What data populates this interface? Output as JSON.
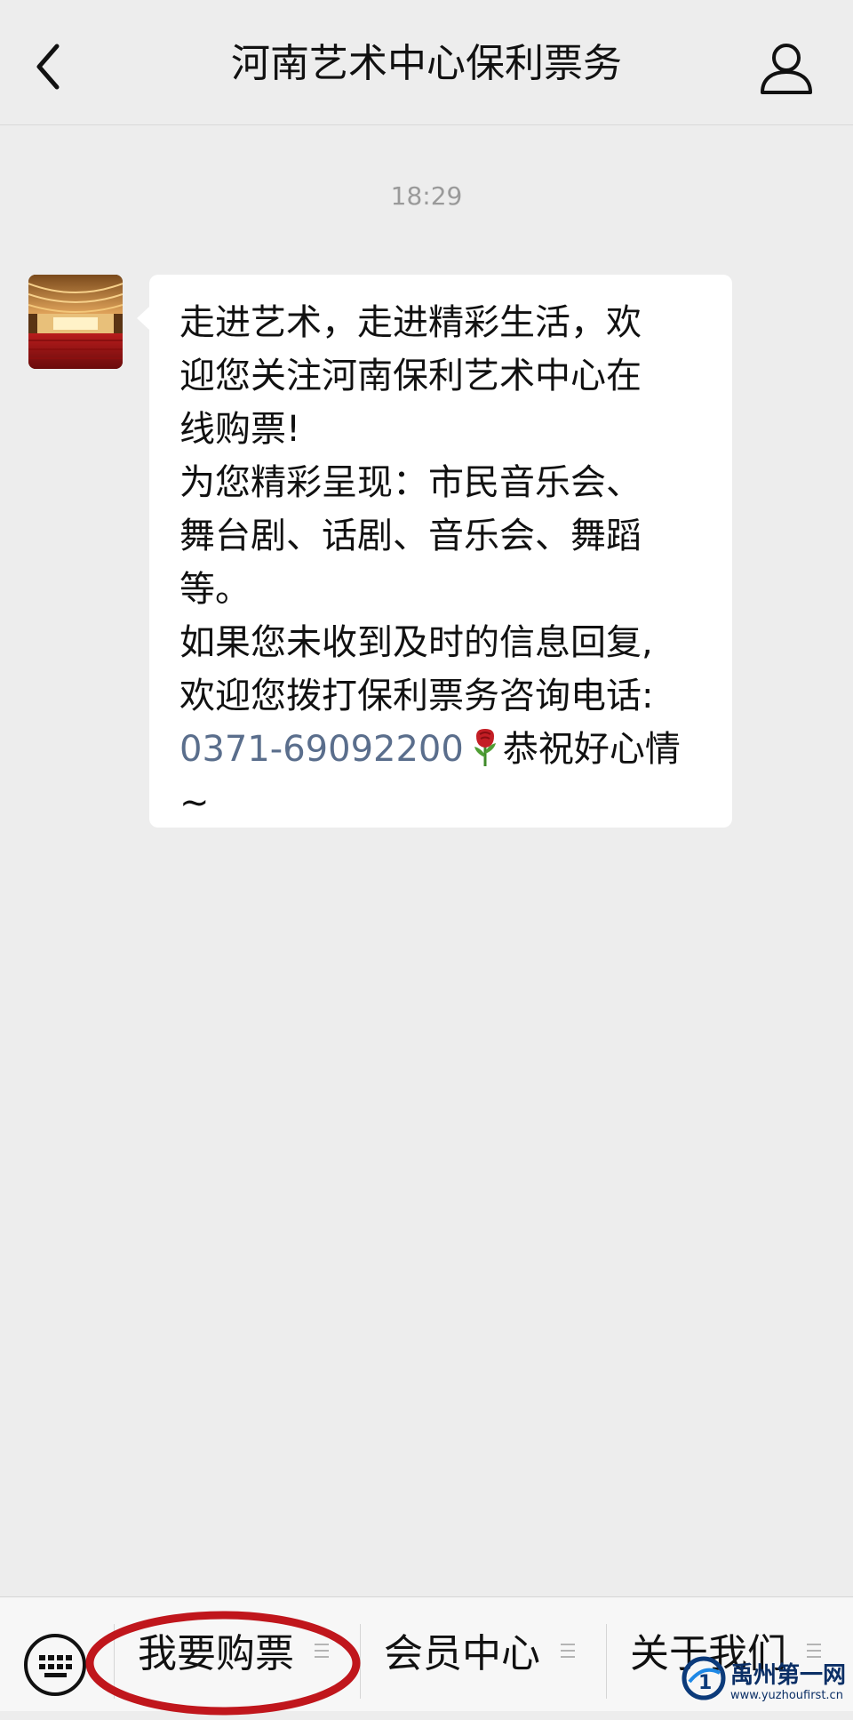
{
  "header": {
    "title": "河南艺术中心保利票务"
  },
  "chat": {
    "timestamp": "18:29",
    "message_lines": [
      "走进艺术，走进精彩生活，欢",
      "迎您关注河南保利艺术中心在",
      "线购票!",
      "为您精彩呈现：市民音乐会、",
      "舞台剧、话剧、音乐会、舞蹈",
      "等。",
      "如果您未收到及时的信息回复,",
      "欢迎您拨打保利票务咨询电话:"
    ],
    "phone": "0371-69092200",
    "closing": "恭祝好心情",
    "tilde": "~"
  },
  "bottom_menu": {
    "items": [
      {
        "label": "我要购票"
      },
      {
        "label": "会员中心"
      },
      {
        "label": "关于我们"
      }
    ]
  },
  "watermark": {
    "text": "禹州第一网",
    "url": "www.yuzhoufirst.cn"
  },
  "colors": {
    "background": "#ededed",
    "bubble": "#ffffff",
    "link": "#5a6e8c",
    "highlight": "#c0161c"
  }
}
